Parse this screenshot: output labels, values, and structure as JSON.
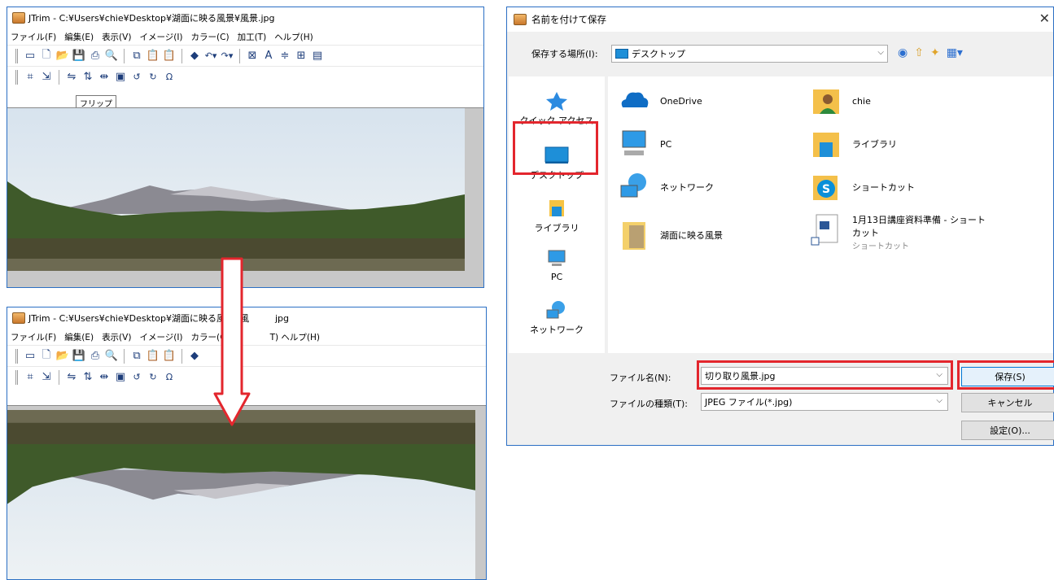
{
  "jtrim": {
    "title": "JTrim - C:¥Users¥chie¥Desktop¥湖面に映る風景¥風景.jpg",
    "title_partial": "JTrim - C:¥Users¥chie¥Desktop¥湖面に映る風景¥風",
    "title_tail": "jpg",
    "menu": [
      "ファイル(F)",
      "編集(E)",
      "表示(V)",
      "イメージ(I)",
      "カラー(C)",
      "加工(T)",
      "ヘルプ(H)"
    ],
    "menu_partial_tail": "T) ヘルプ(H)",
    "tooltip": "フリップ"
  },
  "dialog": {
    "title": "名前を付けて保存",
    "location_label": "保存する場所(I):",
    "location_value": "デスクトップ",
    "places": [
      "クイック アクセス",
      "デスクトップ",
      "ライブラリ",
      "PC",
      "ネットワーク"
    ],
    "files": [
      {
        "name": "OneDrive",
        "icon": "onedrive-icon"
      },
      {
        "name": "chie",
        "icon": "user-folder-icon"
      },
      {
        "name": "PC",
        "icon": "pc-icon"
      },
      {
        "name": "ライブラリ",
        "icon": "library-icon"
      },
      {
        "name": "ネットワーク",
        "icon": "network-icon"
      },
      {
        "name": "ショートカット",
        "icon": "skype-icon"
      },
      {
        "name": "湖面に映る風景",
        "icon": "folder-icon"
      },
      {
        "name": "1月13日講座資料準備 - ショート",
        "line2": "カット",
        "sub": "ショートカット",
        "icon": "word-shortcut-icon"
      }
    ],
    "filename_label": "ファイル名(N):",
    "filename_value": "切り取り風景.jpg",
    "filetype_label": "ファイルの種類(T):",
    "filetype_value": "JPEG ファイル(*.jpg)",
    "save_label": "保存(S)",
    "cancel_label": "キャンセル",
    "settings_label": "設定(O)..."
  },
  "colors": {
    "highlight": "#e3262d",
    "arrow": "#e3262d",
    "window_border": "#2b6fc4"
  }
}
